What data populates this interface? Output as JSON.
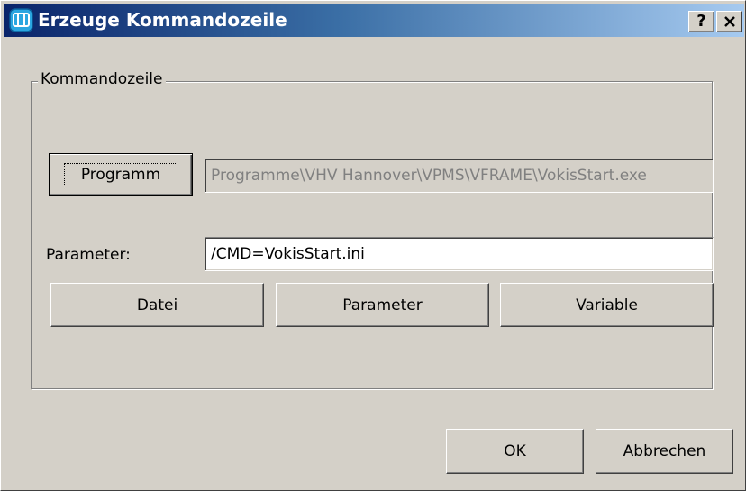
{
  "window": {
    "title": "Erzeuge Kommandozeile",
    "help_button": "?",
    "close_button": "✕"
  },
  "group": {
    "label": "Kommandozeile"
  },
  "program": {
    "button_label": "Programm",
    "path_value": "Programme\\VHV Hannover\\VPMS\\VFRAME\\VokisStart.exe"
  },
  "parameter": {
    "label": "Parameter:",
    "value": "/CMD=VokisStart.ini"
  },
  "buttons": {
    "datei": "Datei",
    "parameter": "Parameter",
    "variable": "Variable"
  },
  "footer": {
    "ok": "OK",
    "cancel": "Abbrechen"
  },
  "colors": {
    "titlebar_start": "#0a246a",
    "titlebar_end": "#a6caf0",
    "face": "#d4d0c8"
  }
}
